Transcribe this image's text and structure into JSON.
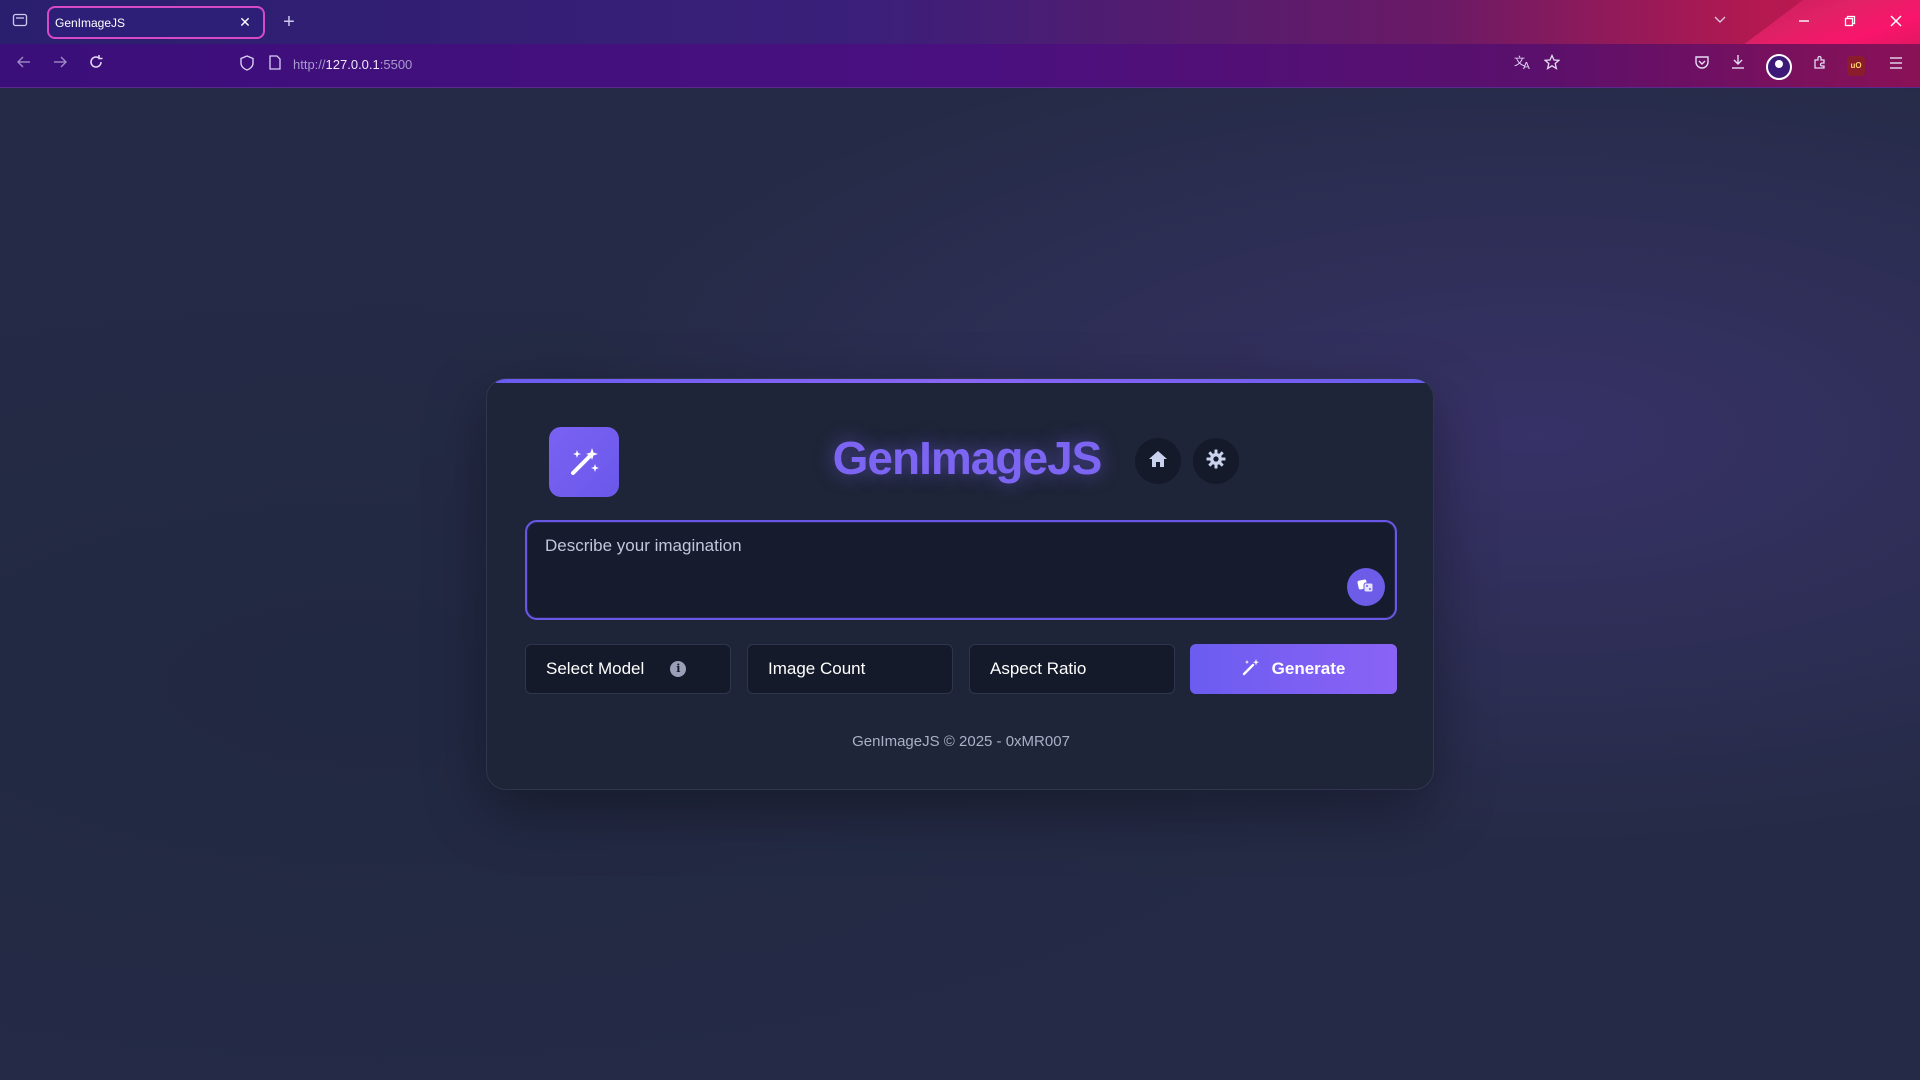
{
  "browser": {
    "tab": {
      "title": "GenImageJS",
      "close": "✕"
    },
    "new_tab": "+",
    "url": {
      "scheme": "http://",
      "host": "127.0.0.1",
      "port": ":5500"
    },
    "icons": {
      "tab_list": "tab-list-icon",
      "back": "back-arrow-icon",
      "forward": "forward-arrow-icon",
      "reload": "reload-icon",
      "shield": "shield-icon",
      "page": "page-icon",
      "translate": "translate-icon",
      "bookmark": "star-icon",
      "pocket": "pocket-icon",
      "download": "download-icon",
      "account": "account-icon",
      "extensions": "extensions-icon",
      "ublock": "ublock-icon",
      "menu": "hamburger-menu-icon"
    }
  },
  "app": {
    "title": "GenImageJS",
    "prompt_placeholder": "Describe your imagination",
    "controls": {
      "model_label": "Select Model",
      "count_label": "Image Count",
      "ratio_label": "Aspect Ratio",
      "generate_label": "Generate"
    },
    "footer": "GenImageJS © 2025 - 0xMR007"
  },
  "colors": {
    "accent": "#7c65f2",
    "card_bg": "#1e2538",
    "page_bg": "#252b46",
    "input_bg": "#141a2a"
  }
}
